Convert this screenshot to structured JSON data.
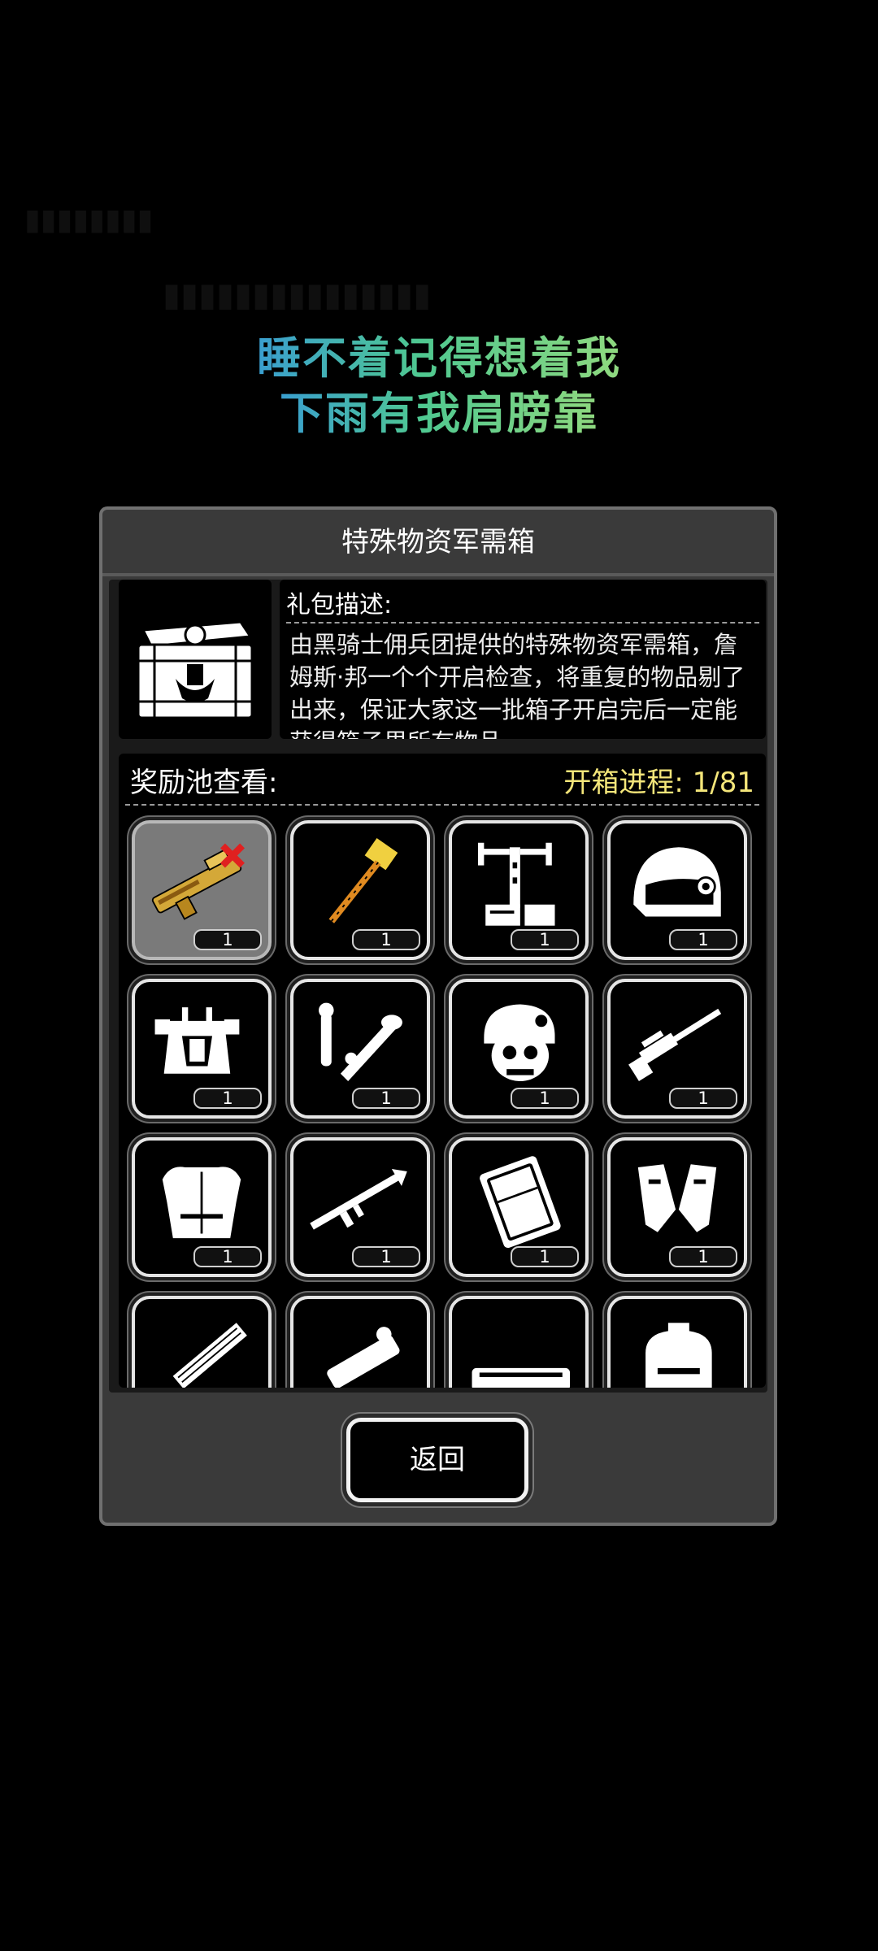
{
  "lyrics": [
    "睡不着记得想着我",
    "下雨有我肩膀靠"
  ],
  "dialog": {
    "title": "特殊物资军需箱",
    "description_label": "礼包描述:",
    "description": "由黑骑士佣兵团提供的特殊物资军需箱，詹姆斯·邦一个个开启检查，将重复的物品剔了出来，保证大家这一批箱子开启完后一定能获得箱子里所有物品",
    "pool_label": "奖励池查看:",
    "progress_label": "开箱进程:",
    "progress_value": "1/81",
    "back_button": "返回"
  },
  "items": [
    {
      "name": "laser-gun-icon",
      "count": "1",
      "selected": true
    },
    {
      "name": "golden-hammer-icon",
      "count": "1"
    },
    {
      "name": "mechanical-arm-kit-icon",
      "count": "1"
    },
    {
      "name": "tactical-helmet-icon",
      "count": "1"
    },
    {
      "name": "chest-rig-armor-icon",
      "count": "1"
    },
    {
      "name": "bones-and-horn-icon",
      "count": "1"
    },
    {
      "name": "skull-helmet-icon",
      "count": "1"
    },
    {
      "name": "sniper-rifle-icon",
      "count": "1"
    },
    {
      "name": "body-armor-icon",
      "count": "1"
    },
    {
      "name": "rocket-launcher-icon",
      "count": "1"
    },
    {
      "name": "supply-crate-icon",
      "count": "1"
    },
    {
      "name": "gauntlets-icon",
      "count": "1"
    },
    {
      "name": "minigun-icon"
    },
    {
      "name": "spiked-club-icon"
    },
    {
      "name": "heavy-blaster-icon"
    },
    {
      "name": "backpack-icon"
    }
  ],
  "colors": {
    "progress": "#f4e67a",
    "lyric_start": "#3a9fd0",
    "lyric_end": "#8fd97f"
  }
}
